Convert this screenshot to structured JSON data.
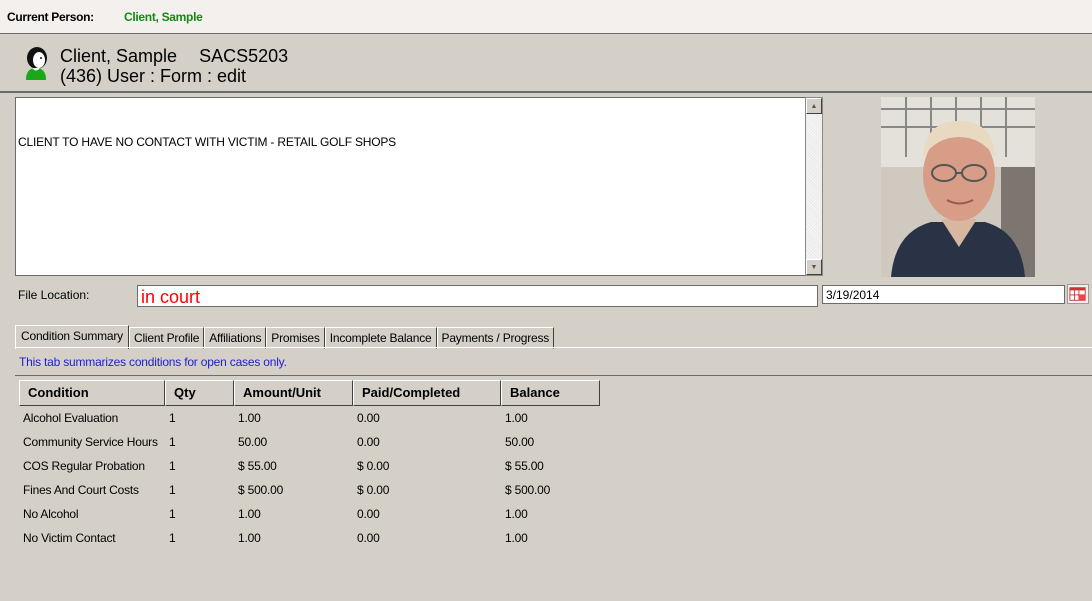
{
  "topbar": {
    "label": "Current Person:",
    "value": "Client, Sample"
  },
  "header": {
    "name": "Client, Sample",
    "id": "SACS5203",
    "form_line": "(436) User : Form : edit",
    "avatar_icon": "client-avatar-icon"
  },
  "notes": {
    "text": "CLIENT TO HAVE NO CONTACT WITH VICTIM - RETAIL GOLF SHOPS"
  },
  "file_location": {
    "label": "File Location:",
    "value": "in court"
  },
  "date": {
    "value": "3/19/2014",
    "icon": "calendar-icon"
  },
  "tabs": [
    {
      "label": "Condition Summary",
      "active": true
    },
    {
      "label": "Client Profile"
    },
    {
      "label": "Affiliations"
    },
    {
      "label": "Promises"
    },
    {
      "label": "Incomplete Balance"
    },
    {
      "label": "Payments / Progress"
    }
  ],
  "tab_note": "This tab summarizes conditions for open cases only.",
  "table": {
    "headers": [
      "Condition",
      "Qty",
      "Amount/Unit",
      "Paid/Completed",
      "Balance"
    ],
    "rows": [
      [
        "Alcohol Evaluation",
        "1",
        "1.00",
        "0.00",
        "1.00"
      ],
      [
        "Community Service Hours",
        "1",
        "50.00",
        "0.00",
        "50.00"
      ],
      [
        "COS Regular Probation",
        "1",
        "$ 55.00",
        "$ 0.00",
        "$ 55.00"
      ],
      [
        "Fines And Court Costs",
        "1",
        "$ 500.00",
        "$ 0.00",
        "$ 500.00"
      ],
      [
        "No Alcohol",
        "1",
        "1.00",
        "0.00",
        "1.00"
      ],
      [
        "No Victim Contact",
        "1",
        "1.00",
        "0.00",
        "1.00"
      ]
    ]
  },
  "colors": {
    "current_person": "#138a13",
    "file_location_text": "#ff0000",
    "tab_note": "#2020d0"
  }
}
